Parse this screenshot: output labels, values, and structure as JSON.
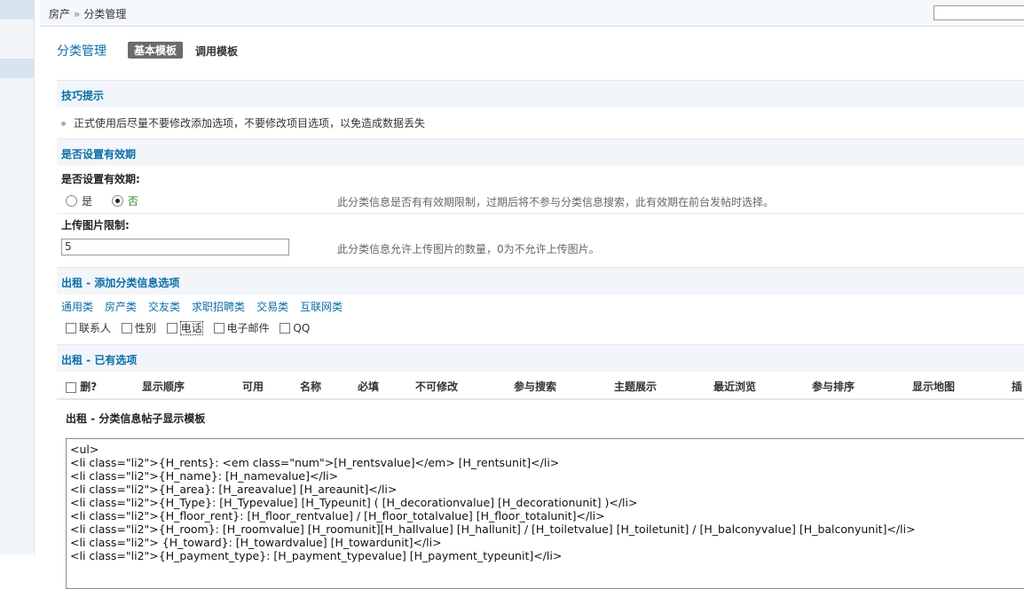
{
  "breadcrumb": {
    "section": "房产",
    "separator": "»",
    "page": "分类管理"
  },
  "header": {
    "title": "分类管理",
    "tabs": [
      {
        "label": "基本模板",
        "active": true
      },
      {
        "label": "调用模板",
        "active": false
      }
    ]
  },
  "tips": {
    "heading": "技巧提示",
    "text": "正式使用后尽量不要修改添加选项，不要修改项目选项，以免造成数据丢失"
  },
  "validity": {
    "heading": "是否设置有效期",
    "label": "是否设置有效期:",
    "options": [
      {
        "label": "是",
        "checked": false
      },
      {
        "label": "否",
        "checked": true
      }
    ],
    "hint": "此分类信息是否有有效期限制，过期后将不参与分类信息搜索，此有效期在前台发帖时选择。"
  },
  "image_limit": {
    "label": "上传图片限制:",
    "value": "5",
    "hint": "此分类信息允许上传图片的数量，0为不允许上传图片。"
  },
  "add_options": {
    "heading": "出租 - 添加分类信息选项",
    "categories": [
      "通用类",
      "房产类",
      "交友类",
      "求职招聘类",
      "交易类",
      "互联网类"
    ],
    "checkboxes": [
      {
        "label": "联系人",
        "checked": false
      },
      {
        "label": "性别",
        "checked": false
      },
      {
        "label": "电话",
        "checked": false
      },
      {
        "label": "电子邮件",
        "checked": false
      },
      {
        "label": "QQ",
        "checked": false
      }
    ]
  },
  "existing": {
    "heading": "出租 - 已有选项",
    "columns": [
      "删?",
      "显示顺序",
      "可用",
      "名称",
      "必填",
      "不可修改",
      "参与搜索",
      "主题展示",
      "最近浏览",
      "参与排序",
      "显示地图",
      "插"
    ]
  },
  "template": {
    "heading": "出租 - 分类信息帖子显示模板",
    "code": "<ul>\n<li class=\"li2\">{H_rents}: <em class=\"num\">[H_rentsvalue]</em> [H_rentsunit]</li>\n<li class=\"li2\">{H_name}: [H_namevalue]</li>\n<li class=\"li2\">{H_area}: [H_areavalue] [H_areaunit]</li>\n<li class=\"li2\">{H_Type}: [H_Typevalue] [H_Typeunit] ( [H_decorationvalue] [H_decorationunit] )</li>\n<li class=\"li2\">{H_floor_rent}: [H_floor_rentvalue] / [H_floor_totalvalue] [H_floor_totalunit]</li>\n<li class=\"li2\">{H_room}: [H_roomvalue] [H_roomunit][H_hallvalue] [H_hallunit] / [H_toiletvalue] [H_toiletunit] / [H_balconyvalue] [H_balconyunit]</li>\n<li class=\"li2\"> {H_toward}: [H_towardvalue] [H_towardunit]</li>\n<li class=\"li2\">{H_payment_type}: [H_payment_typevalue] [H_payment_typeunit]</li>"
  },
  "colors": {
    "accent": "#0a6ea8",
    "tab_active_bg": "#6b6b6b",
    "section_bg": "#f2f6fb",
    "selected_option": "#2a8a2a"
  }
}
